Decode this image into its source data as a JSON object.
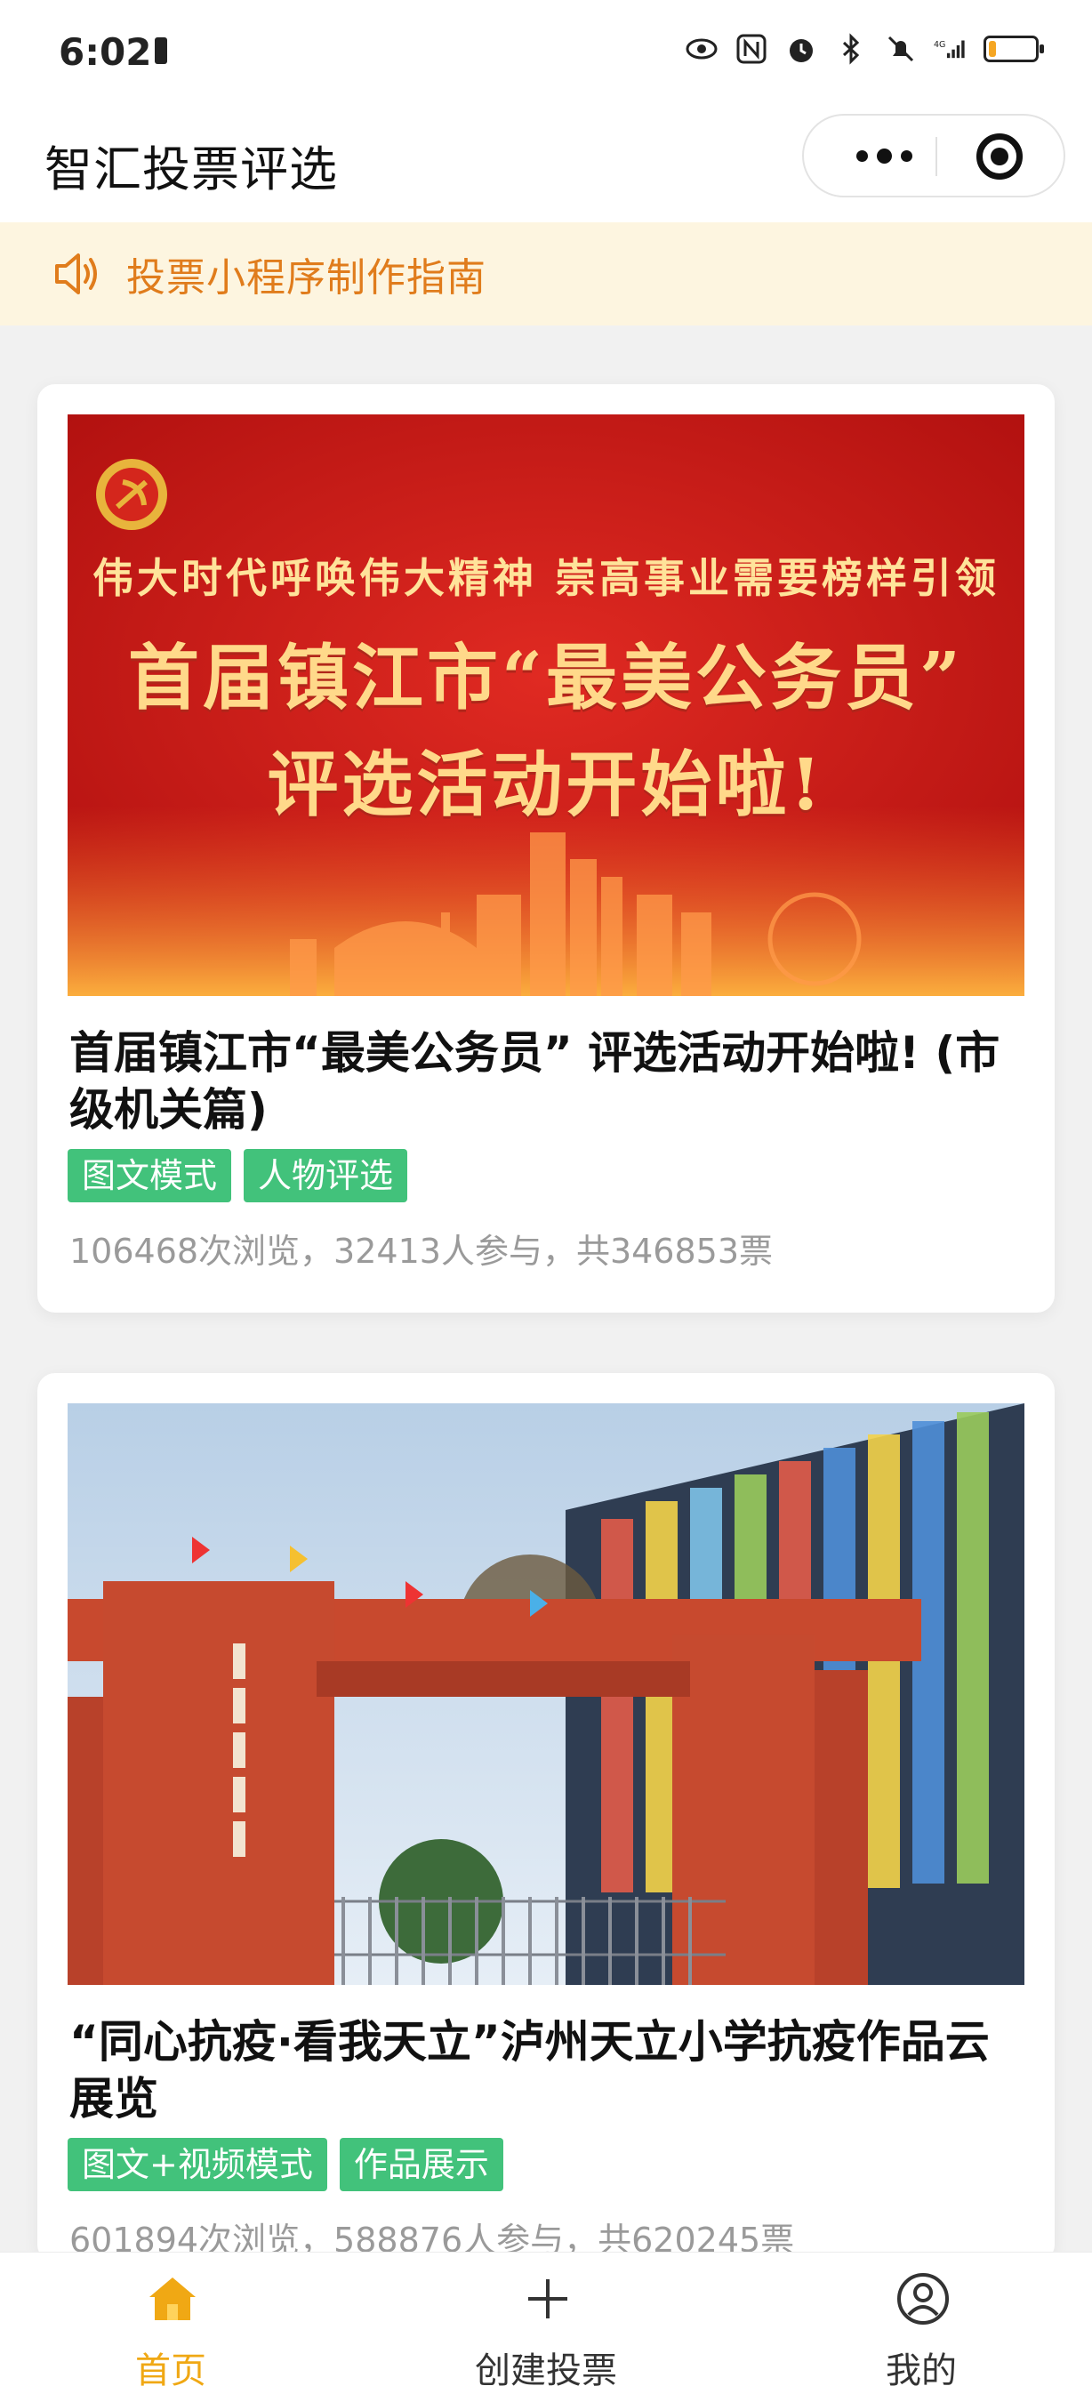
{
  "status_bar": {
    "time": "6:02",
    "network": "4G",
    "battery_level": 0.15
  },
  "nav": {
    "title": "智汇投票评选"
  },
  "notice": {
    "text": "投票小程序制作指南"
  },
  "cards": [
    {
      "banner": {
        "line1": "伟大时代呼唤伟大精神 崇高事业需要榜样引领",
        "line2": "首届镇江市“最美公务员”",
        "line3": "评选活动开始啦!"
      },
      "title": "首届镇江市“最美公务员” 评选活动开始啦! (市级机关篇)",
      "tags": [
        "图文模式",
        "人物评选"
      ],
      "stats": "106468次浏览，32413人参与，共346853票"
    },
    {
      "title": "“同心抗疫·看我天立”泸州天立小学抗疫作品云展览",
      "tags": [
        "图文+视频模式",
        "作品展示"
      ],
      "stats": "601894次浏览，588876人参与，共620245票"
    }
  ],
  "tabs": [
    {
      "label": "首页",
      "icon": "home-icon",
      "active": true
    },
    {
      "label": "创建投票",
      "icon": "plus-icon",
      "active": false
    },
    {
      "label": "我的",
      "icon": "user-icon",
      "active": false
    }
  ],
  "colors": {
    "accent": "#f0a814",
    "tag_green": "#42c27b",
    "notice_text": "#e07c1c",
    "notice_bg": "#fdf5e0"
  }
}
